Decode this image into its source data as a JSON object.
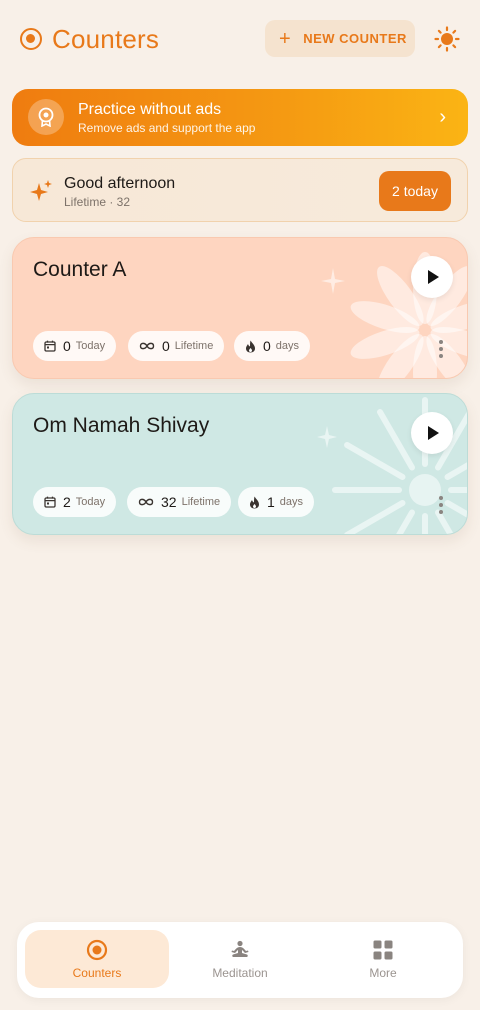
{
  "header": {
    "title": "Counters",
    "new_counter_label": "NEW COUNTER"
  },
  "banner": {
    "title": "Practice without ads",
    "subtitle": "Remove ads and support the app"
  },
  "greeting": {
    "title": "Good afternoon",
    "subtitle": "Lifetime · 32",
    "today_button": "2 today"
  },
  "counters": [
    {
      "name": "Counter A",
      "today_value": "0",
      "today_label": "Today",
      "lifetime_value": "0",
      "lifetime_label": "Lifetime",
      "streak_value": "0",
      "streak_label": "days",
      "color": "#fed5c0"
    },
    {
      "name": "Om Namah Shivay",
      "today_value": "2",
      "today_label": "Today",
      "lifetime_value": "32",
      "lifetime_label": "Lifetime",
      "streak_value": "1",
      "streak_label": "days",
      "color": "#cfe8e4"
    }
  ],
  "nav": {
    "items": [
      {
        "label": "Counters",
        "icon": "target-icon",
        "active": true
      },
      {
        "label": "Meditation",
        "icon": "meditation-icon",
        "active": false
      },
      {
        "label": "More",
        "icon": "grid-icon",
        "active": false
      }
    ]
  },
  "colors": {
    "accent": "#e8791a",
    "background": "#f8f0e8"
  }
}
